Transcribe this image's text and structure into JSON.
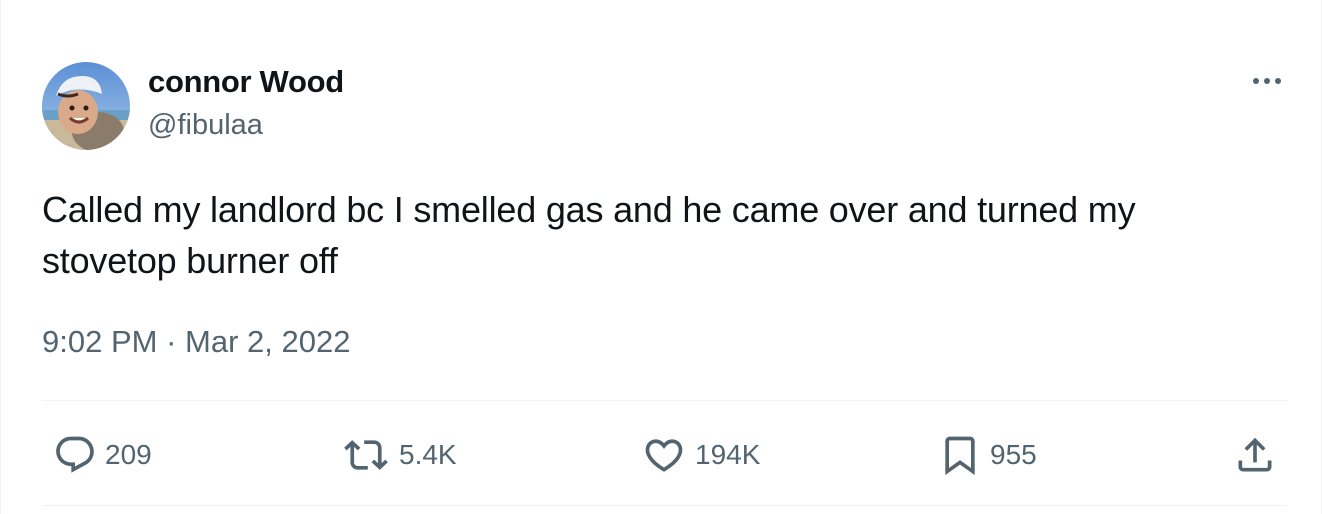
{
  "author": {
    "display_name": "connor Wood",
    "handle": "@fibulaa",
    "avatar_icon": "profile-photo"
  },
  "menu": {
    "more_icon": "ellipsis-icon"
  },
  "tweet": {
    "text": "Called my landlord bc I smelled gas and he came over and turned my stovetop burner off",
    "time": "9:02 PM",
    "separator": "·",
    "date": "Mar 2, 2022"
  },
  "actions": {
    "replies": "209",
    "reposts": "5.4K",
    "likes": "194K",
    "bookmarks": "955",
    "share_icon": "share-icon"
  },
  "colors": {
    "text_primary": "#0f1419",
    "text_secondary": "#536471",
    "divider": "#eff3f4"
  }
}
